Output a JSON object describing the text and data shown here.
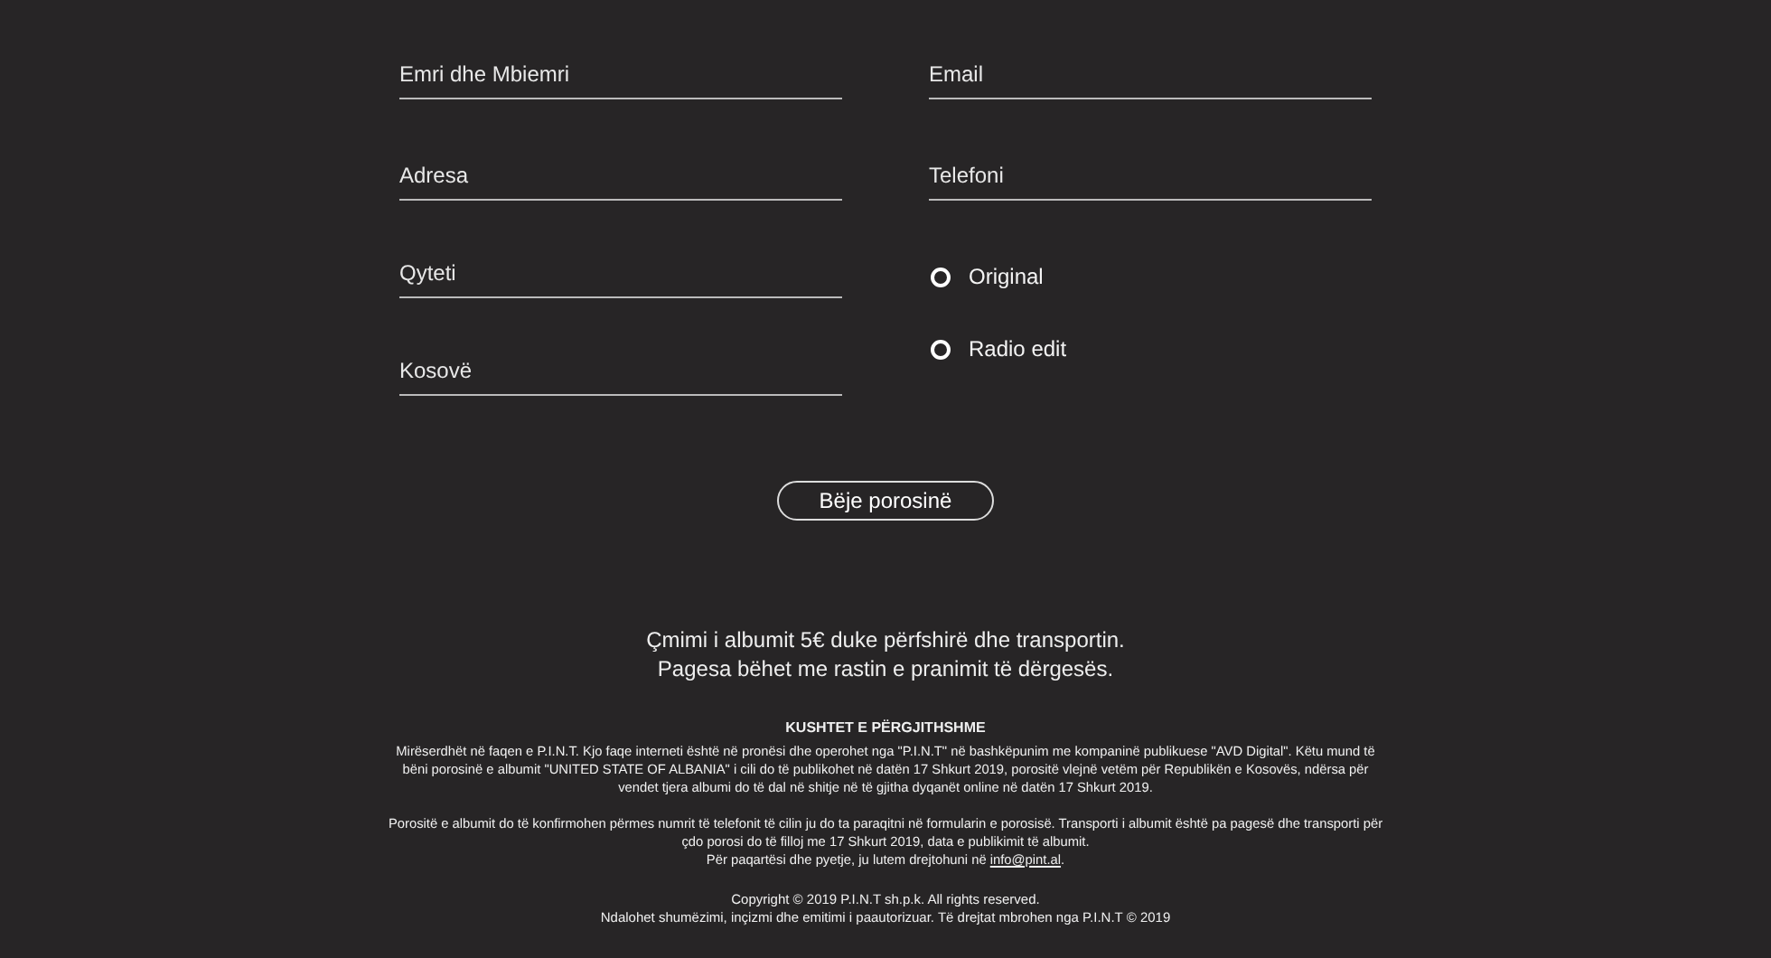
{
  "form": {
    "left_fields": [
      {
        "placeholder": "Emri dhe Mbiemri"
      },
      {
        "placeholder": "Adresa"
      },
      {
        "placeholder": "Qyteti"
      },
      {
        "placeholder": "Kosovë"
      }
    ],
    "right_fields": [
      {
        "placeholder": "Email"
      },
      {
        "placeholder": "Telefoni"
      }
    ],
    "options": [
      {
        "label": "Original",
        "selected": false
      },
      {
        "label": "Radio edit",
        "selected": false
      }
    ],
    "submit": "Bëje porosinë"
  },
  "price_note": [
    "Çmimi i albumit 5€ duke përfshirë dhe transportin.",
    "Pagesa bëhet me rastin e pranimit të dërgesës."
  ],
  "terms": {
    "title": "KUSHTET E PËRGJITHSHME",
    "paragraphs": [
      "Mirëserdhët në faqen e P.I.N.T. Kjo faqe interneti është në pronësi dhe operohet nga \"P.I.N.T\" në bashkëpunim me kompaninë publikuese \"AVD Digital\". Këtu mund të bëni porosinë e albumit \"UNITED STATE OF ALBANIA\" i cili do të publikohet në datën 17 Shkurt 2019, porositë vlejnë vetëm për Republikën e Kosovës, ndërsa për vendet tjera albumi do të dal në shitje në të gjitha dyqanët online në datën 17 Shkurt 2019.",
      "Porositë e albumit do të konfirmohen përmes numrit të telefonit të cilin ju do ta paraqitni në formularin e porosisë. Transporti i albumit është pa pagesë dhe transporti për çdo porosi do të filloj me 17 Shkurt 2019, data e publikimit të albumit."
    ],
    "contact": {
      "text": "Për paqartësi dhe pyetje, ju lutem drejtohuni në",
      "link": "info@pint.al",
      "after": "."
    }
  },
  "footer": [
    "Copyright © 2019 P.I.N.T sh.p.k. All rights reserved.",
    "Ndalohet shumëzimi, inçizmi dhe emitimi i paautorizuar. Të drejtat mbrohen nga P.I.N.T © 2019"
  ]
}
